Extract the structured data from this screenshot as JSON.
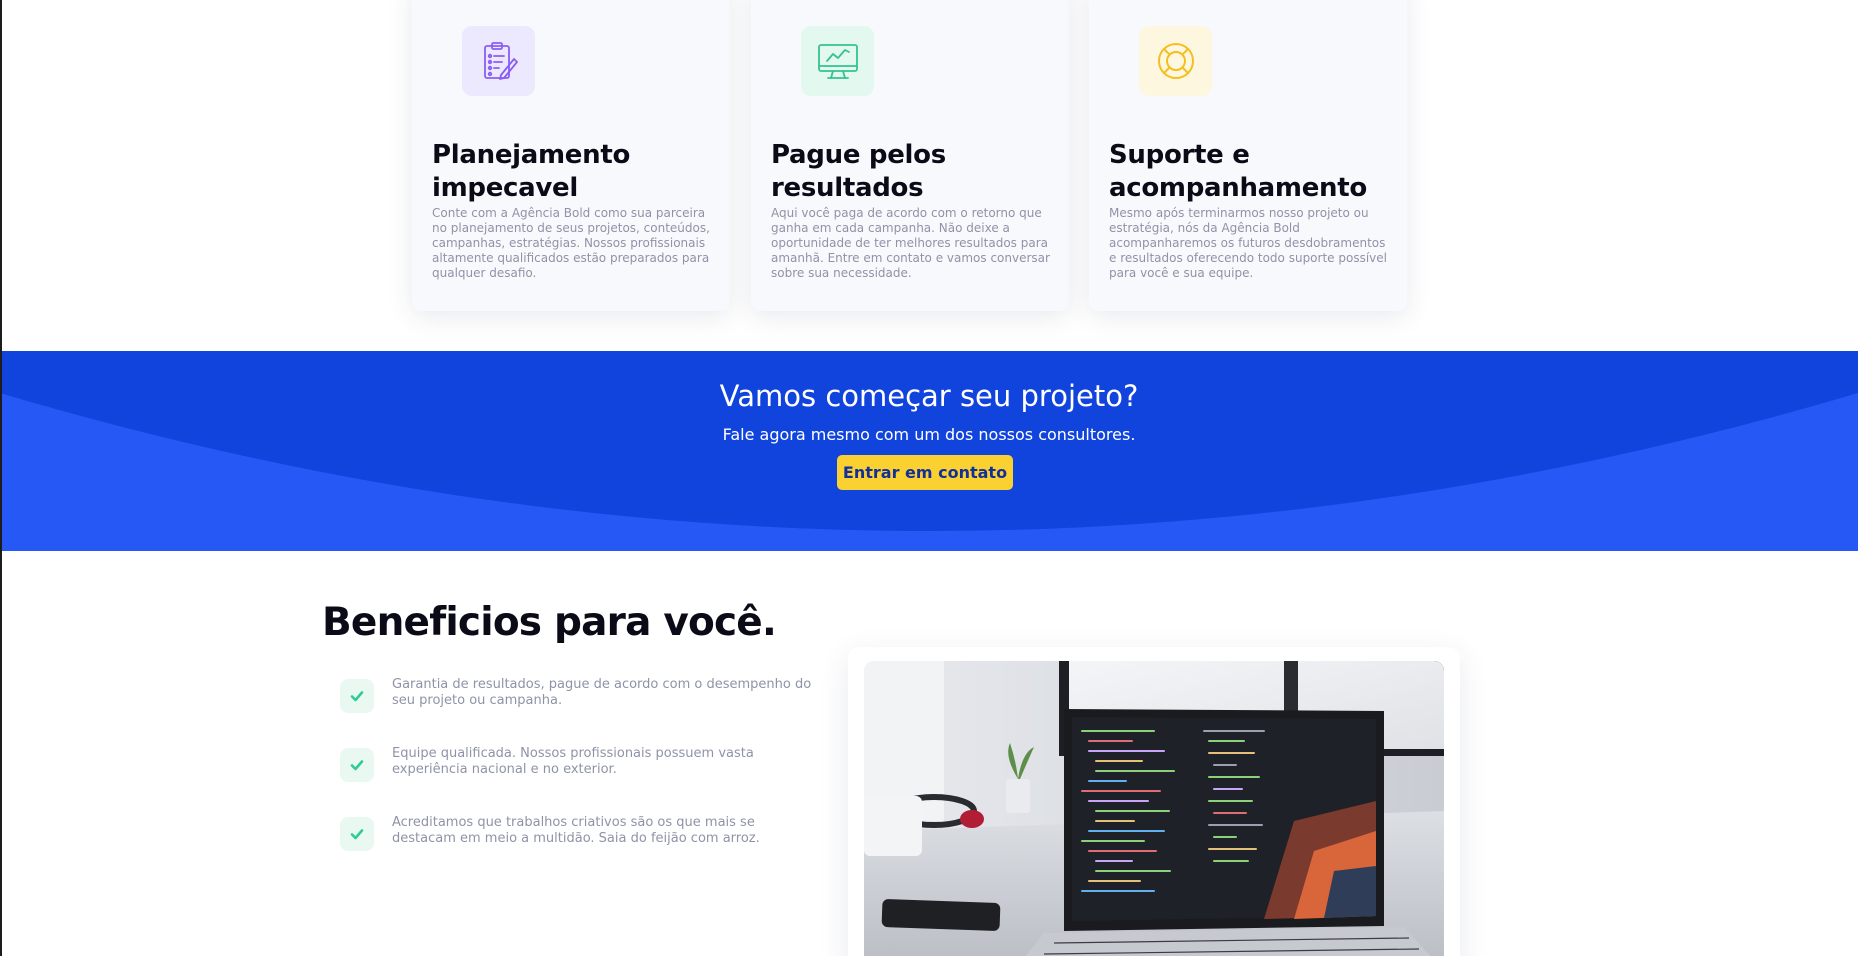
{
  "cards": [
    {
      "icon": "clipboard-edit-icon",
      "icon_bg": "#ece8fd",
      "icon_color": "#8a5cf6",
      "title": "Planejamento impecavel",
      "text": "Conte com a Agência Bold como sua parceira no planejamento de seus projetos, conteúdos, campanhas, estratégias. Nossos profissionais altamente qualificados estão preparados para qualquer desafio."
    },
    {
      "icon": "monitor-chart-icon",
      "icon_bg": "#e3f8ef",
      "icon_color": "#34c38f",
      "title": "Pague pelos resultados",
      "text": "Aqui você paga de acordo com o retorno que ganha em cada campanha. Não deixe a oportunidade de ter melhores resultados para amanhã. Entre em contato e vamos conversar sobre sua necessidade."
    },
    {
      "icon": "lifebuoy-icon",
      "icon_bg": "#fdf7df",
      "icon_color": "#f5be20",
      "title": "Suporte e acompanhamento",
      "text": "Mesmo após terminarmos nosso projeto ou estratégia, nós da Agência Bold acompanharemos os futuros desdobramentos e resultados oferecendo todo suporte possível para você e sua equipe."
    }
  ],
  "cta": {
    "title": "Vamos começar seu projeto?",
    "subtitle": "Fale agora mesmo com um dos nossos consultores.",
    "button_label": "Entrar em contato",
    "bg_color": "#1144dc",
    "wave_color": "#2558f4",
    "button_color": "#fbd031"
  },
  "benefits": {
    "title": "Beneficios para você.",
    "items": [
      {
        "text": "Garantia de resultados, pague de acordo com o desempenho do seu projeto ou campanha."
      },
      {
        "text": "Equipe qualificada. Nossos profissionais possuem vasta experiência nacional e no exterior."
      },
      {
        "text": "Acreditamos que trabalhos criativos são os que mais se destacam em meio a multidão. Saia do feijão com arroz."
      }
    ],
    "check_color": "#2ecc8f",
    "image": "laptop-code-photo"
  }
}
